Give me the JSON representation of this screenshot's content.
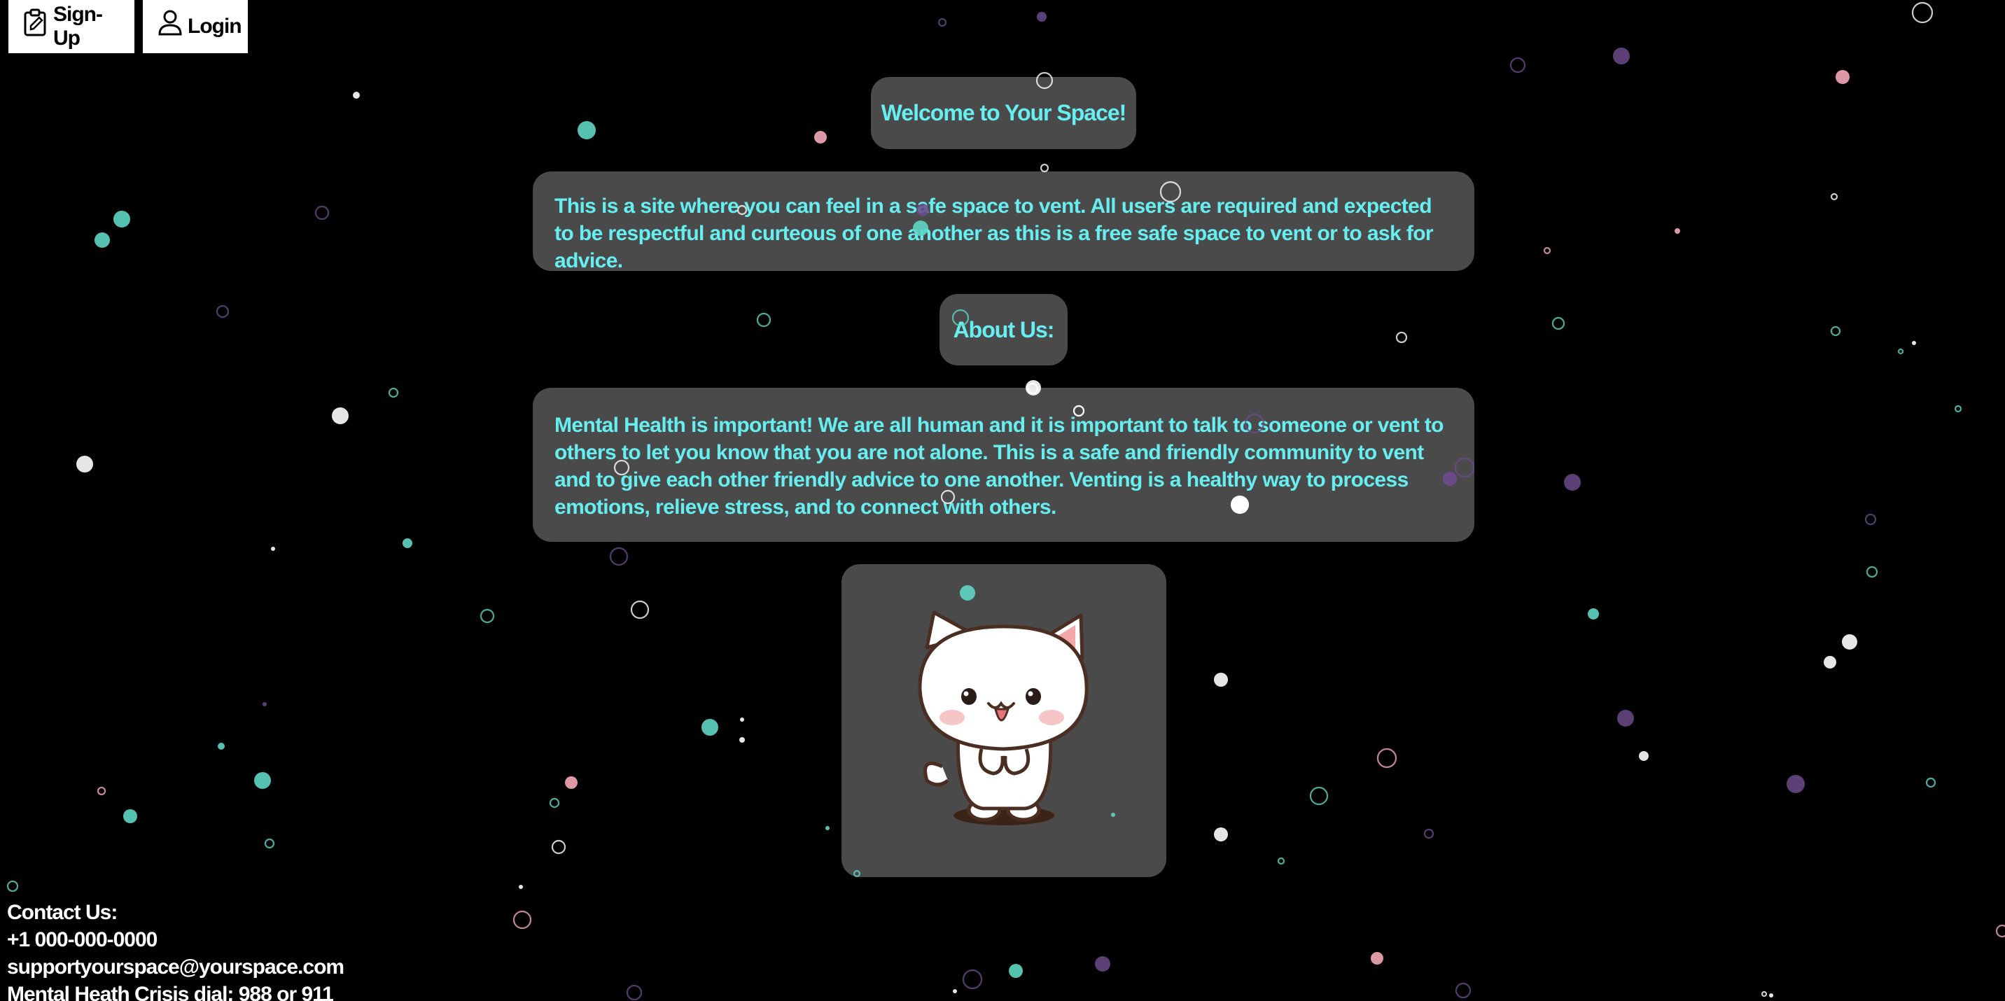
{
  "nav": {
    "signup_label": "Sign-Up",
    "login_label": "Login",
    "signup_icon": "clipboard-edit-icon",
    "login_icon": "user-icon"
  },
  "welcome": {
    "title": "Welcome to Your Space!"
  },
  "intro": {
    "text": "This is a site where you can feel in a safe space to vent. All users are required and expected to be respectful and curteous of one another as this is a free safe space to vent or to ask for advice."
  },
  "about": {
    "title": "About Us:"
  },
  "mission": {
    "text": "Mental Health is important! We are all human and it is important to talk to someone or vent to others to let you know that you are not alone. This is a safe and friendly community to vent and to give each other friendly advice to one another. Venting is a healthy way to process emotions, relieve stress, and to connect with others."
  },
  "mascot": {
    "icon": "cat-mascot-icon"
  },
  "contact": {
    "heading": "Contact Us:",
    "phone": "+1 000-000-0000",
    "email": "supportyourspace@yourspace.com",
    "crisis": "Mental Heath Crisis dial: 988 or 911"
  },
  "colors": {
    "background": "#000000",
    "panel": "#4a4a4a",
    "accent_text": "#66eef0",
    "particle_teal": "#5fd6c3",
    "particle_pink": "#f4a9b8",
    "particle_purple": "#6b4a8a",
    "particle_white": "#ffffff"
  }
}
